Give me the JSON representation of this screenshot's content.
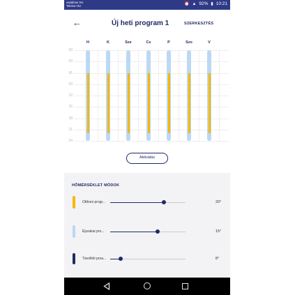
{
  "status_bar": {
    "carrier_line1": "vodafone HU",
    "carrier_line2": "Telenor HU",
    "battery": "92%",
    "time": "10:21"
  },
  "header": {
    "title": "Új heti program 1",
    "edit_label": "SZERKESZTÉS",
    "back_icon": "arrow-left-icon"
  },
  "schedule": {
    "days": [
      "H",
      "K",
      "Sze",
      "Cs",
      "P",
      "Szo",
      "V"
    ],
    "hours": [
      "00",
      "03",
      "06",
      "09",
      "12",
      "15",
      "18",
      "21",
      "24"
    ],
    "day_periods": [
      {
        "day": "H",
        "mode": "Otthoni program",
        "from_hour": 6,
        "to_hour": 22
      },
      {
        "day": "K",
        "mode": "Otthoni program",
        "from_hour": 6,
        "to_hour": 22
      },
      {
        "day": "Sze",
        "mode": "Otthoni program",
        "from_hour": 6,
        "to_hour": 22
      },
      {
        "day": "Cs",
        "mode": "Otthoni program",
        "from_hour": 6,
        "to_hour": 22
      },
      {
        "day": "P",
        "mode": "Otthoni program",
        "from_hour": 6,
        "to_hour": 22
      },
      {
        "day": "Szo",
        "mode": "Otthoni program",
        "from_hour": 6,
        "to_hour": 22
      },
      {
        "day": "V",
        "mode": "Otthoni program",
        "from_hour": 6,
        "to_hour": 22
      }
    ]
  },
  "activate_label": "Aktiválás",
  "modes": {
    "title": "HŐMÉRSÉKLET MÓDOK",
    "items": [
      {
        "name": "Otthoni progr...",
        "temp": "20°",
        "color": "#f5b800",
        "level": 0.71
      },
      {
        "name": "Éjszakai pro...",
        "temp": "15°",
        "color": "#bcd8f3",
        "level": 0.63
      },
      {
        "name": "Távolléti proa...",
        "temp": "8°",
        "color": "#1e2a66",
        "level": 0.14
      }
    ]
  },
  "nav": {
    "back_icon": "triangle-back-icon",
    "home_icon": "circle-home-icon",
    "recent_icon": "square-recents-icon"
  },
  "colors": {
    "status_bar": "#2e3a86",
    "accent": "#1e2a66",
    "home_mode": "#f5b800",
    "night_mode": "#bcd8f3"
  }
}
